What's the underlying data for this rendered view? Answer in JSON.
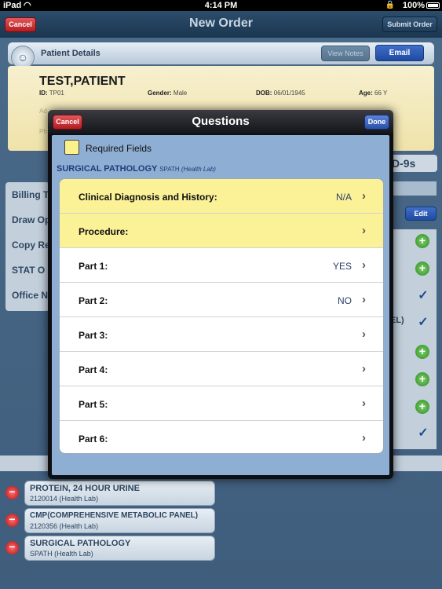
{
  "status_bar": {
    "carrier": "iPad",
    "time": "4:14 PM",
    "battery": "100%"
  },
  "nav": {
    "title": "New Order",
    "cancel_label": "Cancel",
    "submit_label": "Submit Order"
  },
  "patient": {
    "section_title": "Patient Details",
    "view_notes_label": "View Notes",
    "email_label": "Email",
    "name": "TEST,PATIENT",
    "id_label": "ID:",
    "id_value": "TP01",
    "gender_label": "Gender:",
    "gender_value": "Male",
    "dob_label": "DOB:",
    "dob_value": "06/01/1945",
    "age_label": "Age:",
    "age_value": "66 Y",
    "address_label": "Ad",
    "phone_label": "Ph"
  },
  "left_panel": {
    "items": [
      "Billing T",
      "Draw Op",
      "Copy Re",
      "STAT O",
      "Office N"
    ]
  },
  "right_panel": {
    "icd_label": "D-9s",
    "edit_label": "Edit",
    "el_label": "EL)"
  },
  "orders": [
    {
      "name": "PROTEIN, 24 HOUR URINE",
      "code": "2120014 (Health Lab)"
    },
    {
      "name": "CMP(COMPREHENSIVE METABOLIC PANEL)",
      "code": "2120356 (Health Lab)"
    },
    {
      "name": "SURGICAL PATHOLOGY",
      "code": "SPATH (Health Lab)"
    }
  ],
  "modal": {
    "title": "Questions",
    "cancel_label": "Cancel",
    "done_label": "Done",
    "required_label": "Required Fields",
    "section_name": "SURGICAL PATHOLOGY",
    "section_code": "SPATH",
    "section_lab": "(Health Lab)",
    "rows": [
      {
        "label": "Clinical Diagnosis and History:",
        "value": "N/A",
        "required": true
      },
      {
        "label": "Procedure:",
        "value": "",
        "required": true
      },
      {
        "label": "Part 1:",
        "value": "YES",
        "required": false
      },
      {
        "label": "Part 2:",
        "value": "NO",
        "required": false
      },
      {
        "label": "Part 3:",
        "value": "",
        "required": false
      },
      {
        "label": "Part 4:",
        "value": "",
        "required": false
      },
      {
        "label": "Part 5:",
        "value": "",
        "required": false
      },
      {
        "label": "Part 6:",
        "value": "",
        "required": false
      }
    ]
  },
  "colors": {
    "required_yellow": "#fbf197",
    "nav_blue": "#1b3650",
    "done_blue": "#2a4fa8",
    "cancel_red": "#b31c22"
  }
}
